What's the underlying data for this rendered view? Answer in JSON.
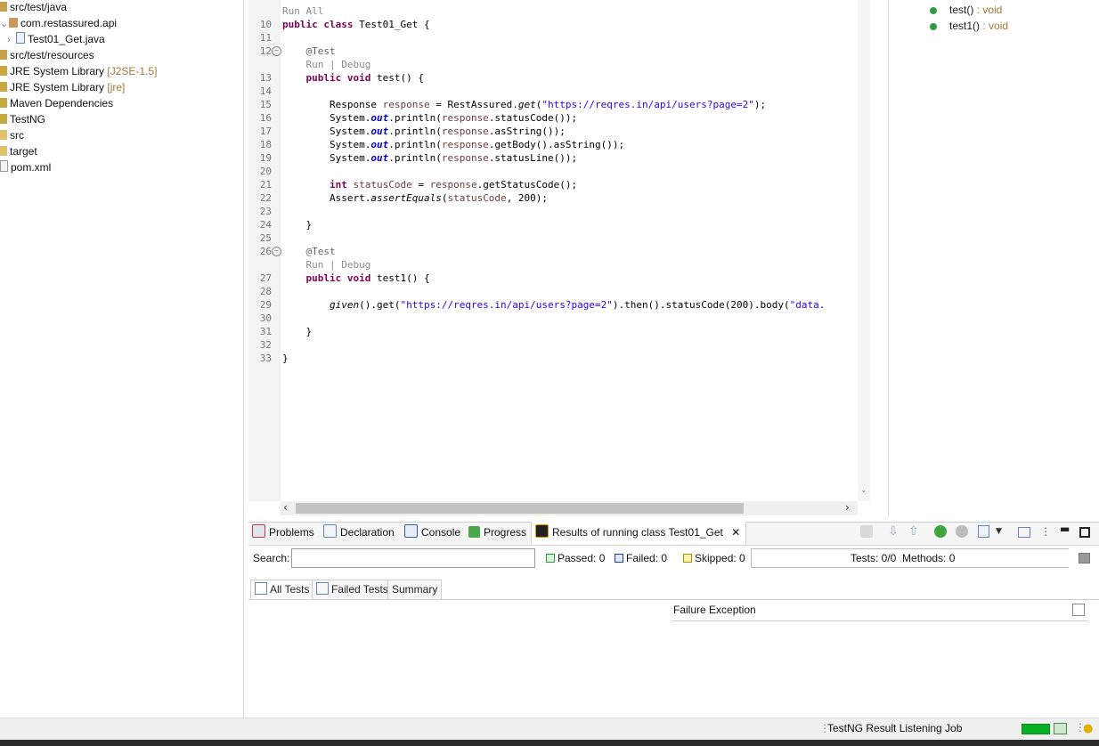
{
  "explorer": {
    "items": [
      {
        "label": "src/test/java",
        "decoration": ""
      },
      {
        "label": "com.restassured.api",
        "decoration": ""
      },
      {
        "label": "Test01_Get.java",
        "decoration": ""
      },
      {
        "label": "src/test/resources",
        "decoration": ""
      },
      {
        "label": "JRE System Library",
        "decoration": "[J2SE-1.5]"
      },
      {
        "label": "JRE System Library",
        "decoration": "[jre]"
      },
      {
        "label": "Maven Dependencies",
        "decoration": ""
      },
      {
        "label": "TestNG",
        "decoration": ""
      },
      {
        "label": "src",
        "decoration": ""
      },
      {
        "label": "target",
        "decoration": ""
      },
      {
        "label": "pom.xml",
        "decoration": ""
      }
    ]
  },
  "editor": {
    "lens_run_all": "Run All",
    "lens_run": "Run",
    "lens_sep": "|",
    "lens_debug": "Debug",
    "line_numbers": [
      "10",
      "11",
      "12",
      "13",
      "14",
      "15",
      "16",
      "17",
      "18",
      "19",
      "20",
      "21",
      "22",
      "23",
      "24",
      "25",
      "26",
      "27",
      "28",
      "29",
      "30",
      "31",
      "32",
      "33"
    ],
    "code": {
      "l10_kw": "public class",
      "l10_rest": " Test01_Get {",
      "l12_ann": "@Test",
      "l13_kw": "public void",
      "l13_rest": " test() {",
      "l15_a": "Response ",
      "l15_var": "response",
      "l15_b": " = RestAssured.",
      "l15_m": "get",
      "l15_c": "(",
      "l15_str": "\"https://reqres.in/api/users?page=2\"",
      "l15_d": ");",
      "sys": "System.",
      "out": "out",
      "println": ".println(",
      "l16_rest": ".statusCode());",
      "l17_rest": ".asString());",
      "l18_rest": ".getBody().asString());",
      "l19_rest": ".statusLine());",
      "l21_kw": "int",
      "l21_var": "statusCode",
      "l21_b": " = ",
      "l21_c": ".getStatusCode();",
      "l22_a": "Assert.",
      "l22_m": "assertEquals",
      "l22_b": "(",
      "l22_c": ", 200);",
      "close": "}",
      "l27_rest": " test1() {",
      "l29_m": "given",
      "l29_a": "().get(",
      "l29_b": ").then().statusCode(200).body(",
      "l29_str2": "\"data."
    }
  },
  "outline": {
    "items": [
      {
        "name": "test()",
        "type": " : void"
      },
      {
        "name": "test1()",
        "type": " : void"
      }
    ]
  },
  "panel": {
    "tabs": [
      "Problems",
      "Declaration",
      "Console",
      "Progress",
      "Results of running class Test01_Get"
    ],
    "close_glyph": "✕",
    "search_label": "Search:",
    "passed": "Passed: 0",
    "failed": "Failed: 0",
    "skipped": "Skipped: 0",
    "tests_summary": "Tests: 0/0  Methods: 0",
    "subtabs": [
      "All Tests",
      "Failed Tests",
      "Summary"
    ],
    "failure_header": "Failure Exception"
  },
  "statusbar": {
    "job": "TestNG Result Listening Job"
  },
  "colors": {
    "keyword": "#7f0055",
    "string": "#2a00ff",
    "progress": "#06b025",
    "passed": "#2e9a3e",
    "failed": "#1f3f8f",
    "skipped": "#d4b000"
  }
}
